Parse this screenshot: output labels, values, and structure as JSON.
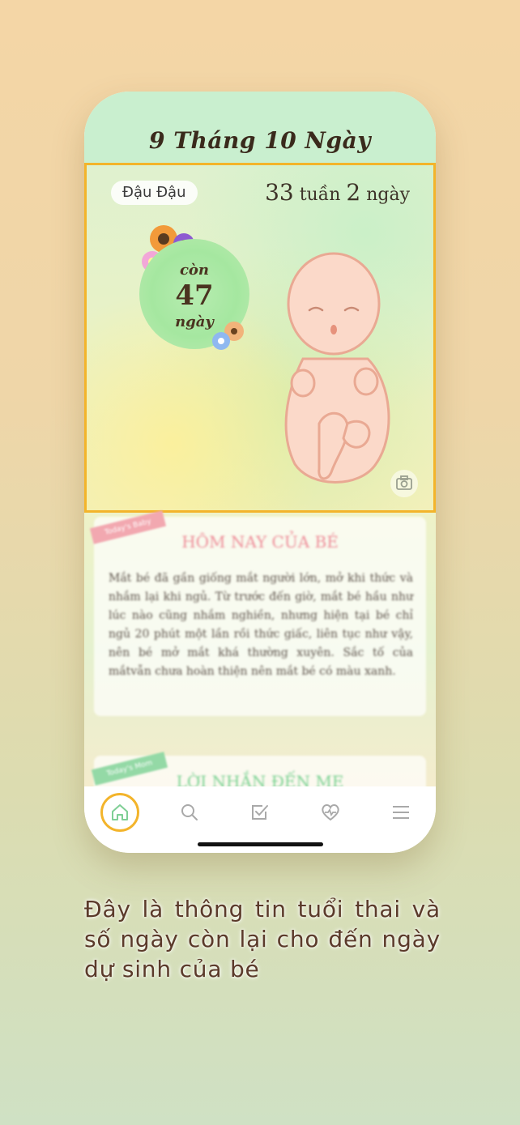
{
  "header": {
    "title": "9 Tháng 10 Ngày"
  },
  "hero": {
    "name": "Đậu Đậu",
    "weeks": "33",
    "weeks_unit": "tuần",
    "days": "2",
    "days_unit": "ngày",
    "countdown_prefix": "còn",
    "countdown_number": "47",
    "countdown_unit": "ngày"
  },
  "card_today": {
    "ribbon": "Today's Baby",
    "title": "HÔM NAY CỦA BÉ",
    "body": "Mắt bé đã gần giống mắt người lớn, mở khi thức và nhắm lại khi ngủ. Từ trước đến giờ, mắt bé hầu như lúc nào cũng nhắm nghiền, nhưng hiện tại bé chỉ ngủ 20 phút một lần rồi thức giấc, liên tục như vậy, nên bé mở mắt khá thường xuyên. Sắc tố của mắtvẫn chưa hoàn thiện nên mắt bé có màu xanh."
  },
  "card_message": {
    "ribbon": "Today's Mom",
    "title": "LỜI NHẮN ĐẾN MẸ"
  },
  "tabbar": {
    "items": [
      {
        "icon": "home-icon",
        "active": true
      },
      {
        "icon": "search-icon",
        "active": false
      },
      {
        "icon": "checklist-icon",
        "active": false
      },
      {
        "icon": "heart-pulse-icon",
        "active": false
      },
      {
        "icon": "menu-icon",
        "active": false
      }
    ]
  },
  "caption": "Đây là thông tin tuổi thai và số ngày còn lại cho đến ngày dự sinh của bé",
  "colors": {
    "header_bg": "#c9efcf",
    "highlight": "#f3b42b",
    "title_pink": "#ee8e99",
    "title_green": "#7cd293"
  }
}
